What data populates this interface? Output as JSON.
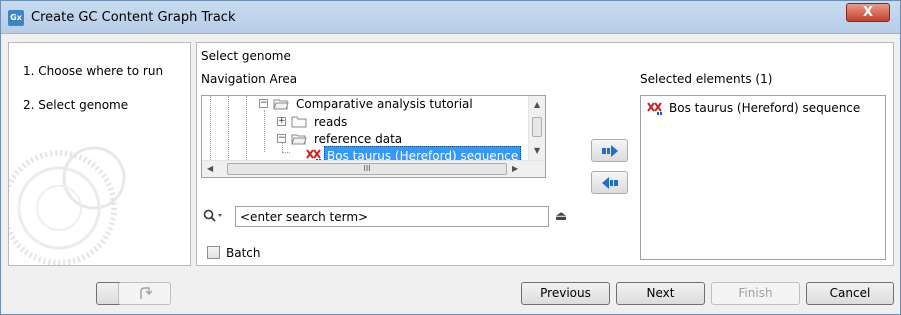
{
  "window": {
    "app_icon_text": "Gx",
    "title": "Create GC Content Graph Track",
    "close_glyph": "X"
  },
  "steps": [
    {
      "label": "1.  Choose where to run"
    },
    {
      "label": "2.  Select genome"
    }
  ],
  "content": {
    "section_title": "Select genome",
    "navigation_label": "Navigation Area",
    "tree": [
      {
        "label": "Comparative analysis tutorial",
        "expander": "−",
        "icon": "folder-open-icon"
      },
      {
        "label": "reads",
        "expander": "+",
        "icon": "folder-icon"
      },
      {
        "label": "reference data",
        "expander": "−",
        "icon": "folder-open-icon"
      },
      {
        "label": "Bos taurus (Hereford) sequence",
        "icon": "sequence-icon",
        "selected": true
      }
    ],
    "hscroll_thumb_glyph": "III",
    "search_placeholder": "<enter search term>",
    "batch_label": "Batch",
    "selected_title": "Selected elements (1)",
    "selected_items": [
      {
        "label": "Bos taurus (Hereford) sequence",
        "icon": "sequence-icon"
      }
    ]
  },
  "buttons": {
    "help": "?",
    "previous": "Previous",
    "next": "Next",
    "finish": "Finish",
    "cancel": "Cancel"
  },
  "colors": {
    "selection": "#3399ff",
    "add_arrow": "#1f6fc5",
    "sequence_icon": "#cc2222"
  }
}
